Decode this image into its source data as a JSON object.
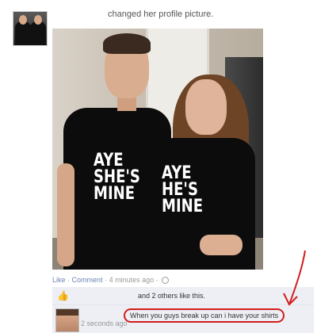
{
  "post": {
    "story": "changed her profile picture.",
    "shirt_text": "AYE\nSHE'S\nMINE",
    "shirt_text_girl": "AYE\nHE'S\nMINE"
  },
  "meta": {
    "like_label": "Like",
    "sep1": "·",
    "comment_label": "Comment",
    "sep2": "·",
    "time": "4 minutes ago",
    "sep3": "·"
  },
  "likes": {
    "icon": "thumbs-up-icon",
    "text": "and 2 others like this."
  },
  "comment": {
    "text": "When you guys break up can i have your shirts",
    "time": "2 seconds ago"
  },
  "colors": {
    "link": "#6d84b4",
    "annotation": "#d21d1d",
    "comment_bg": "#edeff4"
  }
}
